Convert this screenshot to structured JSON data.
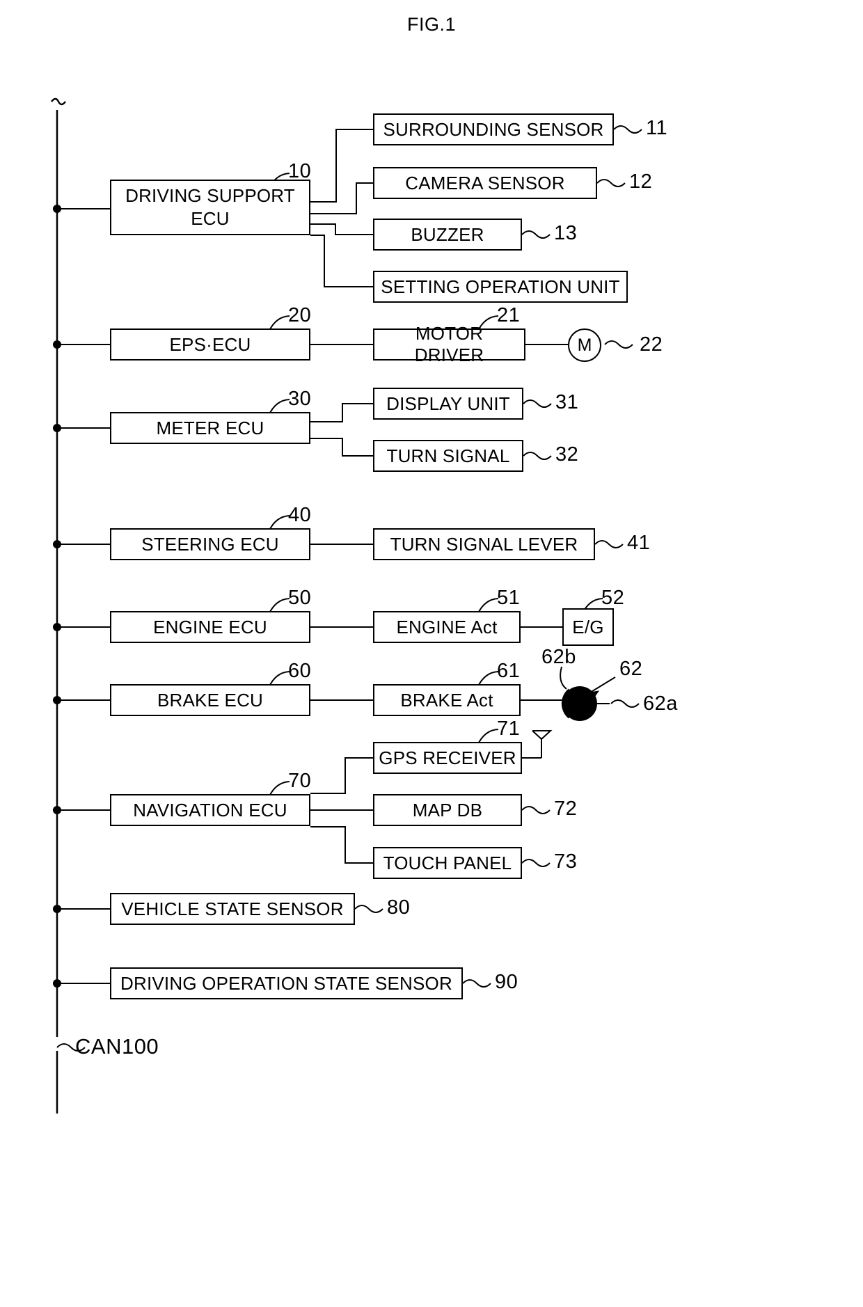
{
  "figure": {
    "title": "FIG.1",
    "bus_label": "CAN100"
  },
  "nodes": {
    "driving_support_ecu": {
      "label_line1": "DRIVING SUPPORT",
      "label_line2": "ECU",
      "ref": "10"
    },
    "surrounding_sensor": {
      "label": "SURROUNDING SENSOR",
      "ref": "11"
    },
    "camera_sensor": {
      "label": "CAMERA SENSOR",
      "ref": "12"
    },
    "buzzer": {
      "label": "BUZZER",
      "ref": "13"
    },
    "setting_operation_unit": {
      "label": "SETTING OPERATION UNIT",
      "ref": ""
    },
    "eps_ecu": {
      "label": "EPS·ECU",
      "ref": "20"
    },
    "motor_driver": {
      "label": "MOTOR DRIVER",
      "ref": "21"
    },
    "motor": {
      "label": "M",
      "ref": "22"
    },
    "meter_ecu": {
      "label": "METER ECU",
      "ref": "30"
    },
    "display_unit": {
      "label": "DISPLAY UNIT",
      "ref": "31"
    },
    "turn_signal": {
      "label": "TURN SIGNAL",
      "ref": "32"
    },
    "steering_ecu": {
      "label": "STEERING ECU",
      "ref": "40"
    },
    "turn_signal_lever": {
      "label": "TURN SIGNAL LEVER",
      "ref": "41"
    },
    "engine_ecu": {
      "label": "ENGINE ECU",
      "ref": "50"
    },
    "engine_act": {
      "label": "ENGINE Act",
      "ref": "51"
    },
    "engine": {
      "label": "E/G",
      "ref": "52"
    },
    "brake_ecu": {
      "label": "BRAKE ECU",
      "ref": "60"
    },
    "brake_act": {
      "label": "BRAKE Act",
      "ref": "61"
    },
    "brake_assembly": {
      "ref": "62",
      "disc_ref": "62a",
      "caliper_ref": "62b"
    },
    "navigation_ecu": {
      "label": "NAVIGATION ECU",
      "ref": "70"
    },
    "gps_receiver": {
      "label": "GPS RECEIVER",
      "ref": "71"
    },
    "map_db": {
      "label": "MAP DB",
      "ref": "72"
    },
    "touch_panel": {
      "label": "TOUCH PANEL",
      "ref": "73"
    },
    "vehicle_state_sensor": {
      "label": "VEHICLE STATE SENSOR",
      "ref": "80"
    },
    "driving_operation_state_sensor": {
      "label": "DRIVING OPERATION STATE SENSOR",
      "ref": "90"
    }
  }
}
